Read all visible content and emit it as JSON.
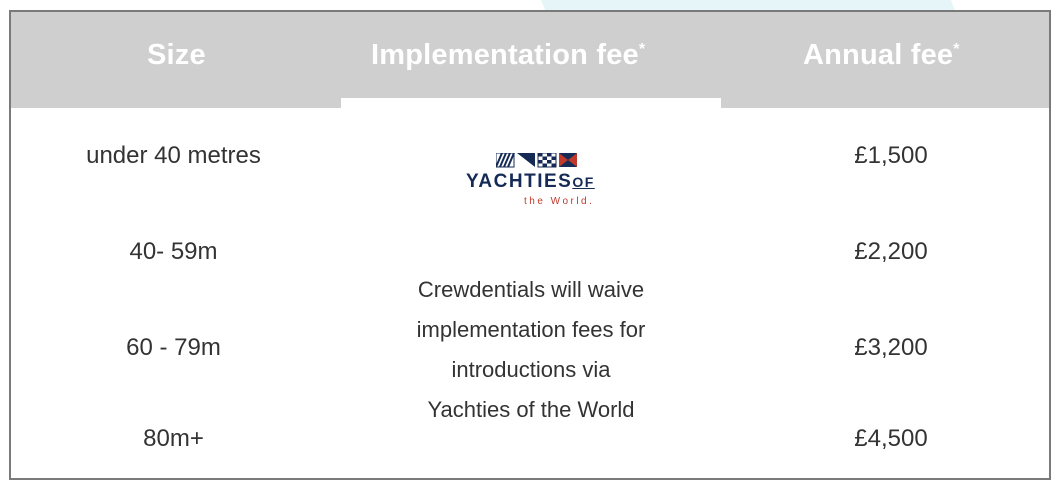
{
  "table": {
    "headers": {
      "size": "Size",
      "implementation": "Implementation fee",
      "implementation_mark": "*",
      "annual": "Annual fee",
      "annual_mark": "*"
    },
    "rows": [
      {
        "size": "under 40 metres",
        "annual": "£1,500"
      },
      {
        "size": "40- 59m",
        "annual": "£2,200"
      },
      {
        "size": "60 - 79m",
        "annual": "£3,200"
      },
      {
        "size": "80m+",
        "annual": "£4,500"
      }
    ],
    "implementation_note": [
      "Crewdentials will waive",
      "implementation fees for",
      "introductions via",
      "Yachties of the World"
    ]
  },
  "logo": {
    "brand": "YACHTIES",
    "brand_suffix": "OF",
    "tagline": "the World."
  },
  "colors": {
    "header_bg": "#cfcfcf",
    "header_text": "#ffffff",
    "brand_navy": "#152a55",
    "brand_red": "#c0392b",
    "border": "#7a7a7a"
  }
}
